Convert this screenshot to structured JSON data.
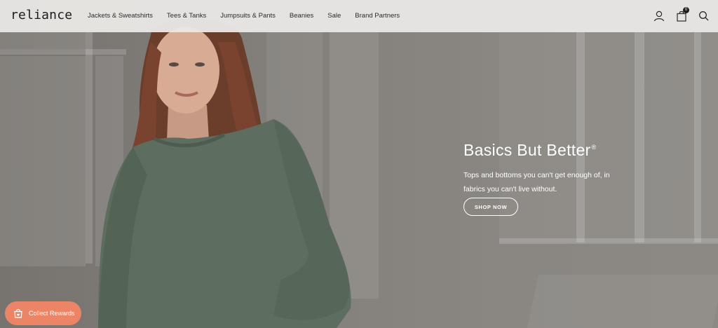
{
  "brand": {
    "logo_text": "reliance"
  },
  "nav": {
    "items": [
      {
        "label": "Jackets & Sweatshirts"
      },
      {
        "label": "Tees & Tanks"
      },
      {
        "label": "Jumpsuits & Pants"
      },
      {
        "label": "Beanies"
      },
      {
        "label": "Sale"
      },
      {
        "label": "Brand Partners"
      }
    ]
  },
  "header_icons": {
    "account": "user-icon",
    "cart": "bag-icon",
    "cart_count": "0",
    "search": "search-icon"
  },
  "hero": {
    "title": "Basics But Better",
    "title_mark": "®",
    "subtitle": "Tops and bottoms you can't get enough of, in fabrics you can't live without.",
    "cta_label": "SHOP NOW"
  },
  "rewards": {
    "label": "Collect Rewards",
    "icon": "shopping-bag-heart-icon",
    "color": "#ec8466"
  },
  "colors": {
    "header_bg": "#e8e7e5",
    "text_dark": "#1c1c1c",
    "hero_text": "#ffffff"
  }
}
